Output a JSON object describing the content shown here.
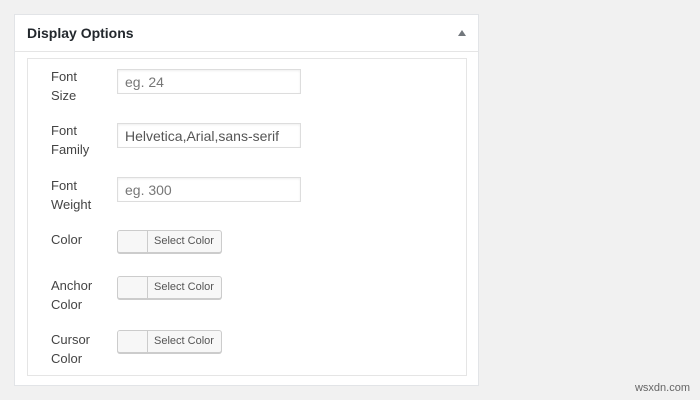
{
  "panel": {
    "title": "Display Options",
    "toggle_icon": "arrow-up-icon"
  },
  "fields": {
    "font_size": {
      "label_line1": "Font",
      "label_line2": "Size",
      "value": "",
      "placeholder": "eg. 24"
    },
    "font_family": {
      "label_line1": "Font",
      "label_line2": "Family",
      "value": "Helvetica,Arial,sans-serif",
      "placeholder": ""
    },
    "font_weight": {
      "label_line1": "Font",
      "label_line2": "Weight",
      "value": "",
      "placeholder": "eg. 300"
    },
    "color": {
      "label": "Color",
      "button_label": "Select Color"
    },
    "anchor_color": {
      "label_line1": "Anchor",
      "label_line2": "Color",
      "button_label": "Select Color"
    },
    "cursor_color": {
      "label_line1": "Cursor",
      "label_line2": "Color",
      "button_label": "Select Color"
    }
  },
  "watermark": "wsxdn.com"
}
